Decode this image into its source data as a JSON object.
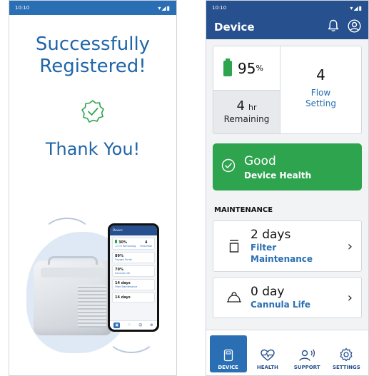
{
  "left_screen": {
    "status_time": "10:10",
    "status_icons": "▾◢▮",
    "headline_line1": "Successfully",
    "headline_line2": "Registered!",
    "thank_you": "Thank You!",
    "mini_app": {
      "title": "Device",
      "battery": "30%",
      "remaining": "1.5 hr Remaining",
      "flow": "4",
      "flow_label": "Flow Rate",
      "row1_value": "89%",
      "row1_label": "Oxygen Purity",
      "row2_value": "70%",
      "row2_label": "Cannula Life",
      "row3_value": "14 days",
      "row3_label": "Filter Maintenance",
      "row4_value": "14 days"
    }
  },
  "right_screen": {
    "status_time": "10:10",
    "status_icons": "▾◢▮",
    "title": "Device",
    "battery_value": "95",
    "battery_unit": "%",
    "remaining_value": "4",
    "remaining_unit": "hr",
    "remaining_label": "Remaining",
    "flow_value": "4",
    "flow_label_line1": "Flow",
    "flow_label_line2": "Setting",
    "health_status": "Good",
    "health_label": "Device Health",
    "maintenance_title": "MAINTENANCE",
    "filter_value": "2 days",
    "filter_label_line1": "Filter",
    "filter_label_line2": "Maintenance",
    "cannula_value": "0 day",
    "cannula_label": "Cannula Life",
    "chevron": "›",
    "nav": [
      "DEVICE",
      "HEALTH",
      "SUPPORT",
      "SETTINGS"
    ]
  },
  "colors": {
    "primary_blue": "#26508e",
    "accent_blue": "#2a6fb4",
    "good_green": "#2ea44f"
  }
}
